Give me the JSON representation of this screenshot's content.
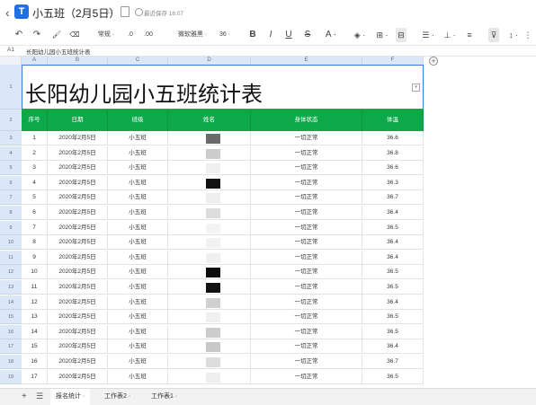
{
  "titlebar": {
    "back_glyph": "‹",
    "logo_letter": "T",
    "title": "小五班（2月5日）",
    "star_icon": "☆",
    "saved_text": "最近保存 16:07"
  },
  "toolbar": {
    "undo": "↶",
    "redo": "↷",
    "format_painter": "🖌",
    "clear": "⌫",
    "number_format": "常规 ·",
    "decrease_decimal": ".0",
    "increase_decimal": ".00",
    "font": "微软雅黑 ·",
    "font_size": "36 ·",
    "bold": "B",
    "italic": "I",
    "underline": "U",
    "strike": "S",
    "font_color": "A ·",
    "fill": "◈ ·",
    "border": "⊞ ·",
    "merge": "⊟",
    "align_h": "☰ ·",
    "align_v": "⊥ ·",
    "wrap": "≡",
    "filter": "⊽",
    "sort": "↕ ·",
    "more": "⋮"
  },
  "formula_bar": {
    "cell_ref": "A1",
    "content": "长阳幼儿园小五班统计表"
  },
  "columns": [
    "A",
    "B",
    "C",
    "D",
    "E",
    "F"
  ],
  "sheet": {
    "title": "长阳幼儿园小五班统计表",
    "headers": [
      "序号",
      "日期",
      "班级",
      "姓名",
      "身体状态",
      "体温"
    ],
    "rows": [
      {
        "row": "3",
        "no": "1",
        "date": "2020年2月5日",
        "class": "小五班",
        "status": "一切正常",
        "temp": "36.6"
      },
      {
        "row": "4",
        "no": "2",
        "date": "2020年2月5日",
        "class": "小五班",
        "status": "一切正常",
        "temp": "36.8"
      },
      {
        "row": "5",
        "no": "3",
        "date": "2020年2月5日",
        "class": "小五班",
        "status": "一切正常",
        "temp": "36.6"
      },
      {
        "row": "6",
        "no": "4",
        "date": "2020年2月5日",
        "class": "小五班",
        "status": "一切正常",
        "temp": "36.3"
      },
      {
        "row": "7",
        "no": "5",
        "date": "2020年2月5日",
        "class": "小五班",
        "status": "一切正常",
        "temp": "36.7"
      },
      {
        "row": "8",
        "no": "6",
        "date": "2020年2月5日",
        "class": "小五班",
        "status": "一切正常",
        "temp": "36.4"
      },
      {
        "row": "9",
        "no": "7",
        "date": "2020年2月5日",
        "class": "小五班",
        "status": "一切正常",
        "temp": "36.5"
      },
      {
        "row": "10",
        "no": "8",
        "date": "2020年2月5日",
        "class": "小五班",
        "status": "一切正常",
        "temp": "36.4"
      },
      {
        "row": "11",
        "no": "9",
        "date": "2020年2月5日",
        "class": "小五班",
        "status": "一切正常",
        "temp": "36.4"
      },
      {
        "row": "12",
        "no": "10",
        "date": "2020年2月5日",
        "class": "小五班",
        "status": "一切正常",
        "temp": "36.5"
      },
      {
        "row": "13",
        "no": "11",
        "date": "2020年2月5日",
        "class": "小五班",
        "status": "一切正常",
        "temp": "36.5"
      },
      {
        "row": "14",
        "no": "12",
        "date": "2020年2月5日",
        "class": "小五班",
        "status": "一切正常",
        "temp": "36.4"
      },
      {
        "row": "15",
        "no": "13",
        "date": "2020年2月5日",
        "class": "小五班",
        "status": "一切正常",
        "temp": "36.5"
      },
      {
        "row": "16",
        "no": "14",
        "date": "2020年2月5日",
        "class": "小五班",
        "status": "一切正常",
        "temp": "36.5"
      },
      {
        "row": "17",
        "no": "15",
        "date": "2020年2月5日",
        "class": "小五班",
        "status": "一切正常",
        "temp": "36.4"
      },
      {
        "row": "18",
        "no": "16",
        "date": "2020年2月5日",
        "class": "小五班",
        "status": "一切正常",
        "temp": "36.7"
      },
      {
        "row": "19",
        "no": "17",
        "date": "2020年2月5日",
        "class": "小五班",
        "status": "一切正常",
        "temp": "36.5"
      }
    ],
    "name_blur_shades": [
      "#6a6a6a",
      "#cccccc",
      "#f0f0f0",
      "#111111",
      "#eeeeee",
      "#dcdcdc",
      "#f4f4f4",
      "#f2f2f2",
      "#f0f0f0",
      "#0d0d0d",
      "#111111",
      "#d0d0d0",
      "#f0f0f0",
      "#cccccc",
      "#c8c8c8",
      "#dddddd",
      "#eeeeee"
    ]
  },
  "sheet_tabs": {
    "add_icon": "+",
    "menu_icon": "☰",
    "tabs": [
      "报名统计 ·",
      "工作表2 ·",
      "工作表1 ·"
    ]
  },
  "colors": {
    "header_green": "#0da84a",
    "selection_blue": "#3a7bd5",
    "column_header_bg": "#dbe7f7"
  }
}
